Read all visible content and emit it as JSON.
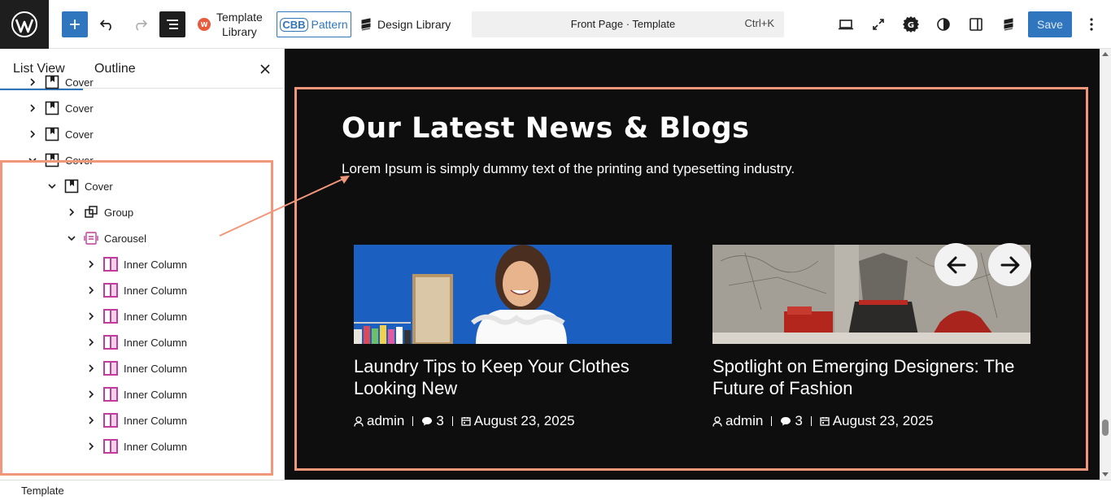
{
  "toolbar": {
    "template_library_label": "Template\nLibrary",
    "pattern_badge": "CBB",
    "pattern_label": "Pattern",
    "design_library_label": "Design Library",
    "command_title": "Front Page · Template",
    "command_shortcut": "Ctrl+K",
    "save_label": "Save"
  },
  "sidebar": {
    "tabs": [
      {
        "label": "List View",
        "active": true
      },
      {
        "label": "Outline",
        "active": false
      }
    ],
    "tree": [
      {
        "label": "Cover",
        "depth": 0,
        "expanded": false,
        "icon": "cover-icon"
      },
      {
        "label": "Cover",
        "depth": 0,
        "expanded": false,
        "icon": "cover-icon"
      },
      {
        "label": "Cover",
        "depth": 0,
        "expanded": false,
        "icon": "cover-icon"
      },
      {
        "label": "Cover",
        "depth": 0,
        "expanded": true,
        "icon": "cover-icon"
      },
      {
        "label": "Cover",
        "depth": 1,
        "expanded": true,
        "icon": "cover-icon"
      },
      {
        "label": "Group",
        "depth": 2,
        "expanded": false,
        "icon": "group-icon"
      },
      {
        "label": "Carousel",
        "depth": 2,
        "expanded": true,
        "icon": "carousel-icon"
      },
      {
        "label": "Inner Column",
        "depth": 3,
        "expanded": false,
        "icon": "inner-column-icon"
      },
      {
        "label": "Inner Column",
        "depth": 3,
        "expanded": false,
        "icon": "inner-column-icon"
      },
      {
        "label": "Inner Column",
        "depth": 3,
        "expanded": false,
        "icon": "inner-column-icon"
      },
      {
        "label": "Inner Column",
        "depth": 3,
        "expanded": false,
        "icon": "inner-column-icon"
      },
      {
        "label": "Inner Column",
        "depth": 3,
        "expanded": false,
        "icon": "inner-column-icon"
      },
      {
        "label": "Inner Column",
        "depth": 3,
        "expanded": false,
        "icon": "inner-column-icon"
      },
      {
        "label": "Inner Column",
        "depth": 3,
        "expanded": false,
        "icon": "inner-column-icon"
      },
      {
        "label": "Inner Column",
        "depth": 3,
        "expanded": false,
        "icon": "inner-column-icon"
      }
    ]
  },
  "canvas": {
    "heading": "Our Latest News & Blogs",
    "subheading": "Lorem Ipsum is simply dummy text of the printing and typesetting industry.",
    "cards": [
      {
        "title": "Laundry Tips to Keep Your Clothes Looking New",
        "author": "admin",
        "comments": "3",
        "date": "August 23, 2025"
      },
      {
        "title": "Spotlight on Emerging Designers: The Future of Fashion",
        "author": "admin",
        "comments": "3",
        "date": "August 23, 2025"
      }
    ]
  },
  "footer": {
    "breadcrumb": "Template"
  },
  "colors": {
    "accent": "#2f76be",
    "highlight": "#f0977b",
    "canvas_bg": "#0e0e0e",
    "inner_column": "#c13c9c"
  }
}
